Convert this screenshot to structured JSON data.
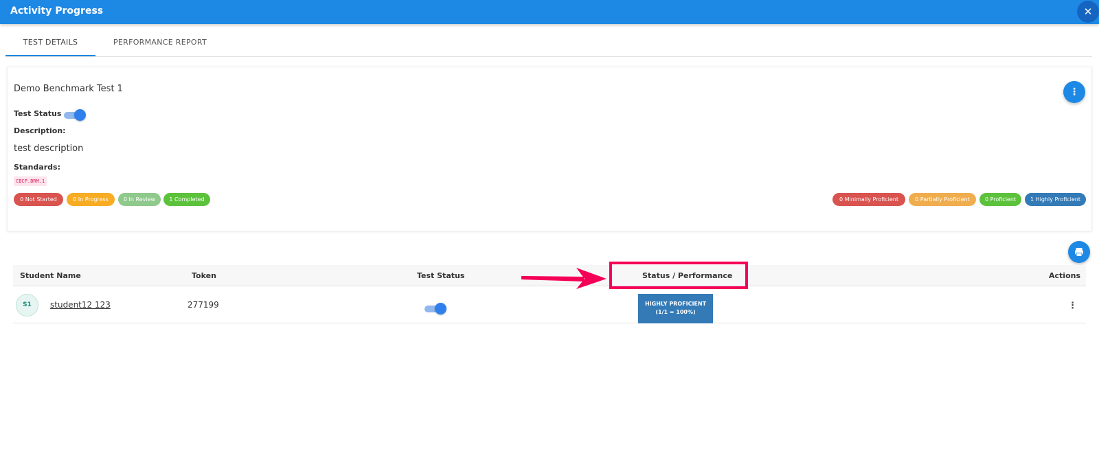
{
  "window": {
    "title": "Activity Progress",
    "close_icon": "close-icon"
  },
  "tabs": [
    {
      "label": "TEST DETAILS",
      "active": true
    },
    {
      "label": "PERFORMANCE REPORT",
      "active": false
    }
  ],
  "test": {
    "name": "Demo Benchmark Test 1",
    "status_label": "Test Status",
    "status_enabled": true,
    "description_label": "Description:",
    "description": "test description",
    "standards_label": "Standards:",
    "standards": [
      "CBCP.BRM.1"
    ]
  },
  "progress_counts": [
    {
      "label": "0 Not Started",
      "color": "#d9534f"
    },
    {
      "label": "0 In Progress",
      "color": "#f8ac23"
    },
    {
      "label": "0 In Review",
      "color": "#8fc98b"
    },
    {
      "label": "1 Completed",
      "color": "#5cc23c"
    }
  ],
  "proficiency_counts": [
    {
      "label": "0 Minimally Proficient",
      "color": "#d9534f"
    },
    {
      "label": "0 Partially Proficient",
      "color": "#f0ad4e"
    },
    {
      "label": "0 Proficient",
      "color": "#5cc23c"
    },
    {
      "label": "1 Highly Proficient",
      "color": "#337ab7"
    }
  ],
  "table": {
    "headers": {
      "student_name": "Student Name",
      "token": "Token",
      "test_status": "Test Status",
      "status_performance": "Status / Performance",
      "actions": "Actions"
    },
    "rows": [
      {
        "initials": "S1",
        "student_name": "student12 123",
        "token": "277199",
        "test_status_enabled": true,
        "performance_line1": "HIGHLY PROFICIENT",
        "performance_line2": "(1/1 = 100%)",
        "performance_color": "#337ab7"
      }
    ]
  },
  "annotation": {
    "highlight_color": "#f50057"
  }
}
